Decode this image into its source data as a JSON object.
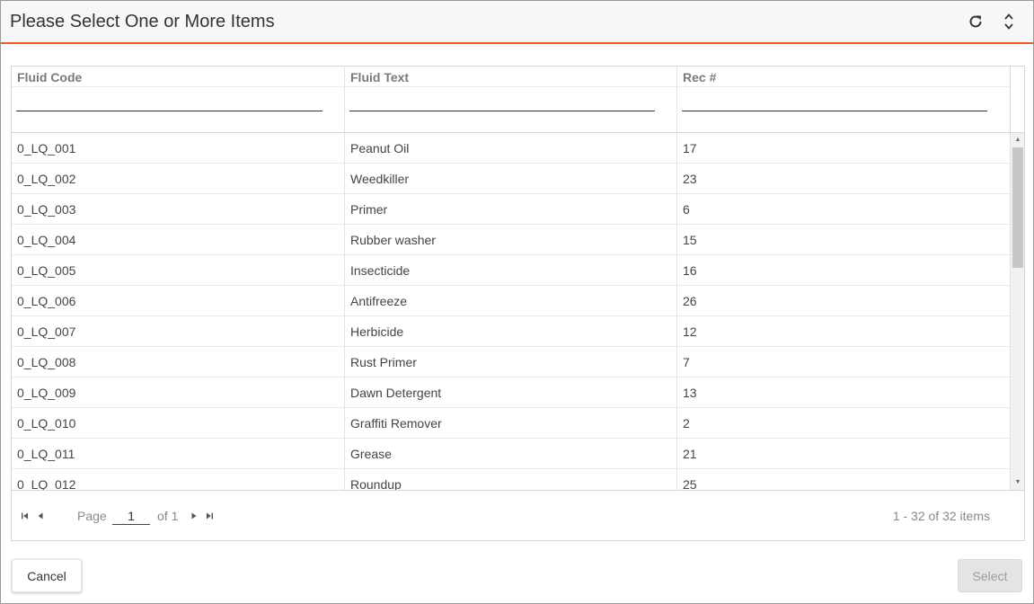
{
  "dialog": {
    "title": "Please Select One or More Items",
    "icons": [
      "refresh-icon",
      "expand-collapse-icon"
    ]
  },
  "grid": {
    "columns": [
      {
        "label": "Fluid Code",
        "filter": ""
      },
      {
        "label": "Fluid Text",
        "filter": ""
      },
      {
        "label": "Rec #",
        "filter": ""
      }
    ],
    "rows": [
      [
        "0_LQ_001",
        "Peanut Oil",
        "17"
      ],
      [
        "0_LQ_002",
        "Weedkiller",
        "23"
      ],
      [
        "0_LQ_003",
        "Primer",
        "6"
      ],
      [
        "0_LQ_004",
        "Rubber washer",
        "15"
      ],
      [
        "0_LQ_005",
        "Insecticide",
        "16"
      ],
      [
        "0_LQ_006",
        "Antifreeze",
        "26"
      ],
      [
        "0_LQ_007",
        "Herbicide",
        "12"
      ],
      [
        "0_LQ_008",
        "Rust Primer",
        "7"
      ],
      [
        "0_LQ_009",
        "Dawn Detergent",
        "13"
      ],
      [
        "0_LQ_010",
        "Graffiti Remover",
        "2"
      ],
      [
        "0_LQ_011",
        "Grease",
        "21"
      ],
      [
        "0_LQ_012",
        "Roundup",
        "25"
      ]
    ]
  },
  "pager": {
    "page_label": "Page",
    "page_value": "1",
    "of_label": "of 1",
    "info": "1 - 32 of 32 items"
  },
  "footer": {
    "cancel_label": "Cancel",
    "select_label": "Select"
  },
  "colors": {
    "accent": "#e35e25",
    "titlebar_bg": "#f7f7f7",
    "disabled_button_bg": "#e4e4e4"
  }
}
